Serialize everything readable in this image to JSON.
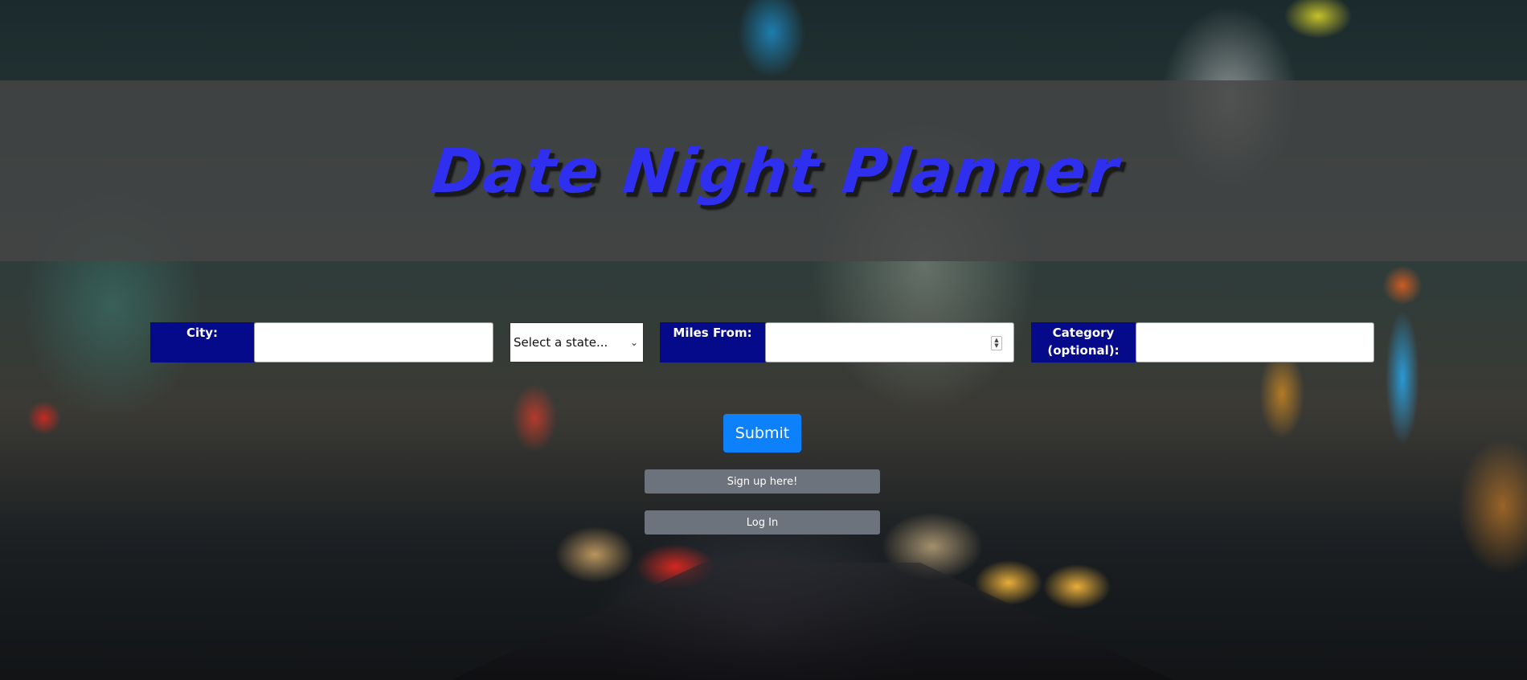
{
  "header": {
    "title": "Date Night Planner"
  },
  "form": {
    "city_label": "City:",
    "city_value": "",
    "state_selected": "Select a state...",
    "miles_label": "Miles From:",
    "miles_value": "",
    "category_label_line1": "Category",
    "category_label_line2": "(optional):",
    "category_value": ""
  },
  "actions": {
    "submit_label": "Submit",
    "signup_label": "Sign up here!",
    "login_label": "Log In"
  },
  "colors": {
    "title": "#2f2ff0",
    "label_bg": "#040a8a",
    "submit_bg": "#0d80fc",
    "secondary_bg": "#6c737c"
  }
}
